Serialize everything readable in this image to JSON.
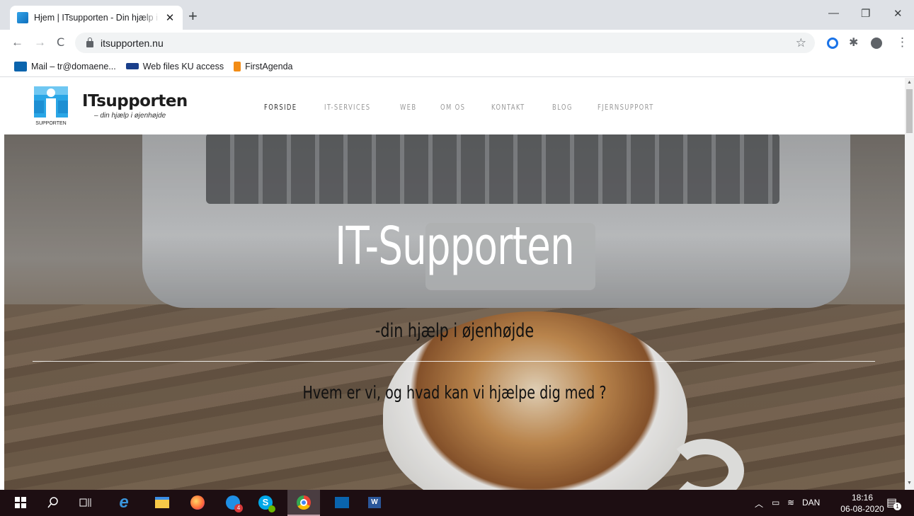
{
  "browser": {
    "tab_title": "Hjem | ITsupporten - Din hjælp i øjenhøjde",
    "tab_close": "✕",
    "new_tab": "+",
    "url": "itsupporten.nu",
    "window_minimize": "—",
    "window_restore": "❐",
    "window_close": "✕",
    "back": "←",
    "forward": "→",
    "reload": "C",
    "star": "☆",
    "menu": "⋮"
  },
  "bookmarks": [
    {
      "label": "Mail – tr@domaene...",
      "icon": "outlook-icon",
      "color": "#0a64ad"
    },
    {
      "label": "Web files KU access",
      "icon": "ku-icon",
      "color": "#1a3f8b"
    },
    {
      "label": "FirstAgenda",
      "icon": "firstagenda-icon",
      "color": "#f28c16"
    }
  ],
  "site": {
    "logo_title": "ITsupporten",
    "logo_sub": "– din hjælp i øjenhøjde",
    "logo_mark_text": "SUPPORTEN",
    "nav": [
      "FORSIDE",
      "IT-SERVICES",
      "WEB",
      "OM OS",
      "KONTAKT",
      "BLOG",
      "FJERNSUPPORT"
    ],
    "active_nav": "FORSIDE",
    "hero_title": "IT-Supporten",
    "hero_subtitle": "-din hjælp i øjenhøjde",
    "hero_question": "Hvem er vi, og hvad kan vi hjælpe dig med ?"
  },
  "taskbar": {
    "icons": [
      "windows-start-icon",
      "search-icon",
      "task-view-icon",
      "edge-icon",
      "file-explorer-icon",
      "firefox-icon",
      "skype-business-icon",
      "skype-icon",
      "chrome-icon",
      "outlook-icon",
      "word-icon"
    ],
    "skype_business_badge": "4",
    "tray_language": "DAN",
    "time": "18:16",
    "date": "06-08-2020",
    "notification_count": "1"
  },
  "colors": {
    "tabstrip": "#dee1e6",
    "taskbar": "#1d0e12",
    "nav_active": "#333333",
    "nav_inactive": "#9a9a9a"
  }
}
